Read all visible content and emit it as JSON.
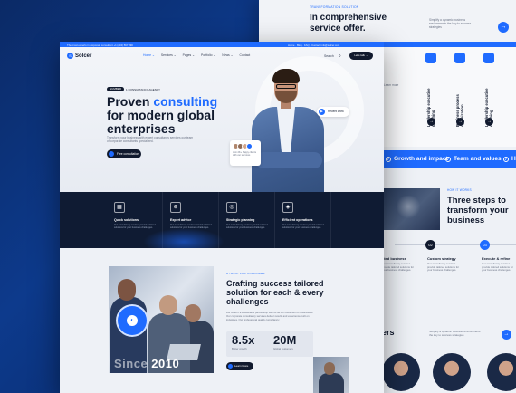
{
  "back": {
    "top": {
      "eyebrow": "TRANSFORMATION SOLUTION",
      "title_line1": "In comprehensive",
      "title_line2": "service offer.",
      "para": "Simplify a dynamic business environments the key to success strategies",
      "arrow": "→"
    },
    "nav": [
      "Home",
      "Pages",
      "Blog",
      "Contact us",
      "info@solcer.com"
    ],
    "cards": [
      {
        "title": "Leadership executive coaching",
        "arrow": "→"
      },
      {
        "title": "Business process optimization",
        "arrow": "→"
      },
      {
        "title": "Leadership executive coaching",
        "arrow": "→"
      }
    ],
    "learn_more": "Learn more",
    "strip": [
      "Growth and impact",
      "Team and values",
      "Ho"
    ],
    "three_steps": {
      "eyebrow": "HOW IT WORKS",
      "title_line1": "Three steps to",
      "title_line2": "transform your",
      "title_line3": "business"
    },
    "steps": [
      {
        "num": "",
        "title": "ated business",
        "desc": "Our consultancy services provide tailored solutions for your business challenges."
      },
      {
        "num": "02",
        "title": "Custom strategy",
        "desc": "Our consultancy services provide tailored solutions for your business challenges."
      },
      {
        "num": "03",
        "title": "Execute & refine",
        "desc": "Our consultancy services provide tailored solutions for your business challenges."
      }
    ],
    "team": {
      "title": "ers",
      "para": "Simplify a dynamic business environments the key to success strategies",
      "arrow": "→"
    }
  },
  "topbar": {
    "left": "The most experts in corporate consultant  +1 (234) 567 890",
    "right": "Home  ·  Blog  ·  FAQ  ·  Contact   info@solcer.com"
  },
  "header": {
    "logo_mark": "S",
    "logo_name": "Solcer",
    "menu": [
      "Home ⌄",
      "Services ⌄",
      "Pages ⌄",
      "Portfolio ⌄",
      "News ⌄",
      "Contact"
    ],
    "search_label": "Search",
    "search_icon": "⌕",
    "cta": "Let's talk →"
  },
  "hero": {
    "badge_pill": "NUMBER",
    "badge_text": "1 CONSULTANCY AGENCY",
    "title_line1": "Proven ",
    "title_blue": "consulting",
    "title_line2": "for modern global",
    "title_line3": "enterprises",
    "para": "Transform your business with expert consultancy services our team of corporate consultants specialized.",
    "cta": "Free consultation",
    "recent_label": "Recent work",
    "recent_icon": "▶",
    "client_text": "Join 2K+ happy clients with our services"
  },
  "services": [
    {
      "icon": "▦",
      "title": "Quick solutions",
      "desc": "Our consultancy services provide tailored solutions for your business challenges."
    },
    {
      "icon": "⊕",
      "title": "Expert advice",
      "desc": "Our consultancy services provide tailored solutions for your business challenges."
    },
    {
      "icon": "◎",
      "title": "Strategic planning",
      "desc": "Our consultancy services provide tailored solutions for your business challenges."
    },
    {
      "icon": "◈",
      "title": "Efficient operations",
      "desc": "Our consultancy services provide tailored solutions for your business challenges."
    }
  ],
  "about": {
    "eyebrow": "A TRUST FOR COMPANIES",
    "title_line1": "Crafting success tailored",
    "title_line2": "solution for each & every",
    "title_line3": "challenges",
    "para": "We make it a sustainable partnership with us all our industries for businesses. Our corporate consultancy services deliver results and experience built on industries. Our professional quality consultancy.",
    "stat1_num": "8.5x",
    "stat1_label": "Better growth",
    "stat2_num": "20M",
    "stat2_label": "Global customers",
    "cta": "Learn More",
    "since_prefix": "Since ",
    "since_year": "2010",
    "badge_icon": "◐"
  },
  "colors": {
    "accent": "#1f6bff",
    "dark": "#111a2e",
    "services_bg": "#0f1b33",
    "background": "#0d3a8c"
  }
}
